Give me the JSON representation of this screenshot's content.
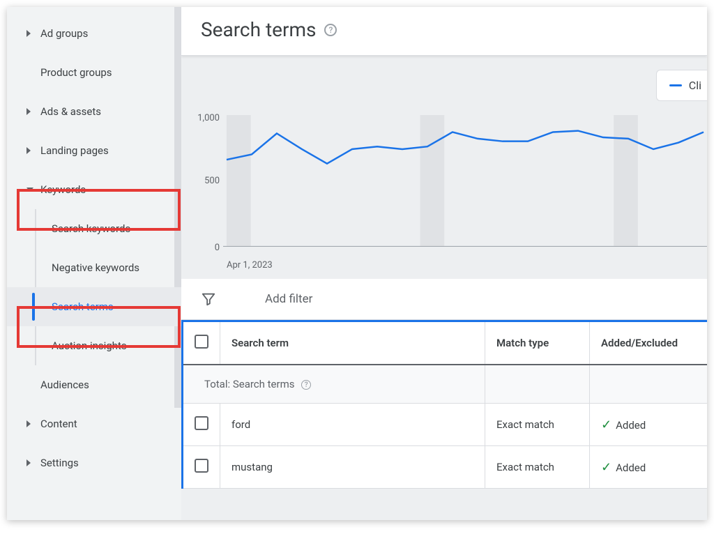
{
  "sidebar": {
    "items": [
      {
        "label": "Ad groups",
        "caret": "right"
      },
      {
        "label": "Product groups",
        "caret": "none"
      },
      {
        "label": "Ads & assets",
        "caret": "right"
      },
      {
        "label": "Landing pages",
        "caret": "right"
      },
      {
        "label": "Keywords",
        "caret": "down"
      },
      {
        "label": "Search keywords"
      },
      {
        "label": "Negative keywords"
      },
      {
        "label": "Search terms"
      },
      {
        "label": "Auction insights"
      },
      {
        "label": "Audiences",
        "caret": "none"
      },
      {
        "label": "Content",
        "caret": "right"
      },
      {
        "label": "Settings",
        "caret": "right"
      }
    ]
  },
  "header": {
    "title": "Search terms"
  },
  "chart": {
    "legend_label": "Cli",
    "y_ticks": [
      "1,000",
      "500",
      "0"
    ],
    "x_start": "Apr 1, 2023"
  },
  "chart_data": {
    "type": "line",
    "title": "Search terms",
    "ylabel": "Clicks",
    "ylim": [
      0,
      1000
    ],
    "x": [
      0,
      1,
      2,
      3,
      4,
      5,
      6,
      7,
      8,
      9,
      10,
      11,
      12,
      13,
      14,
      15,
      16,
      17,
      18,
      19
    ],
    "values": [
      660,
      700,
      860,
      740,
      630,
      740,
      760,
      740,
      760,
      870,
      820,
      800,
      800,
      870,
      880,
      830,
      820,
      740,
      790,
      870
    ],
    "x_start_label": "Apr 1, 2023"
  },
  "filter": {
    "add_label": "Add filter"
  },
  "table": {
    "headers": {
      "term": "Search term",
      "match": "Match type",
      "status": "Added/Excluded"
    },
    "total_label": "Total: Search terms",
    "rows": [
      {
        "term": "ford",
        "match": "Exact match",
        "status": "Added"
      },
      {
        "term": "mustang",
        "match": "Exact match",
        "status": "Added"
      }
    ]
  }
}
